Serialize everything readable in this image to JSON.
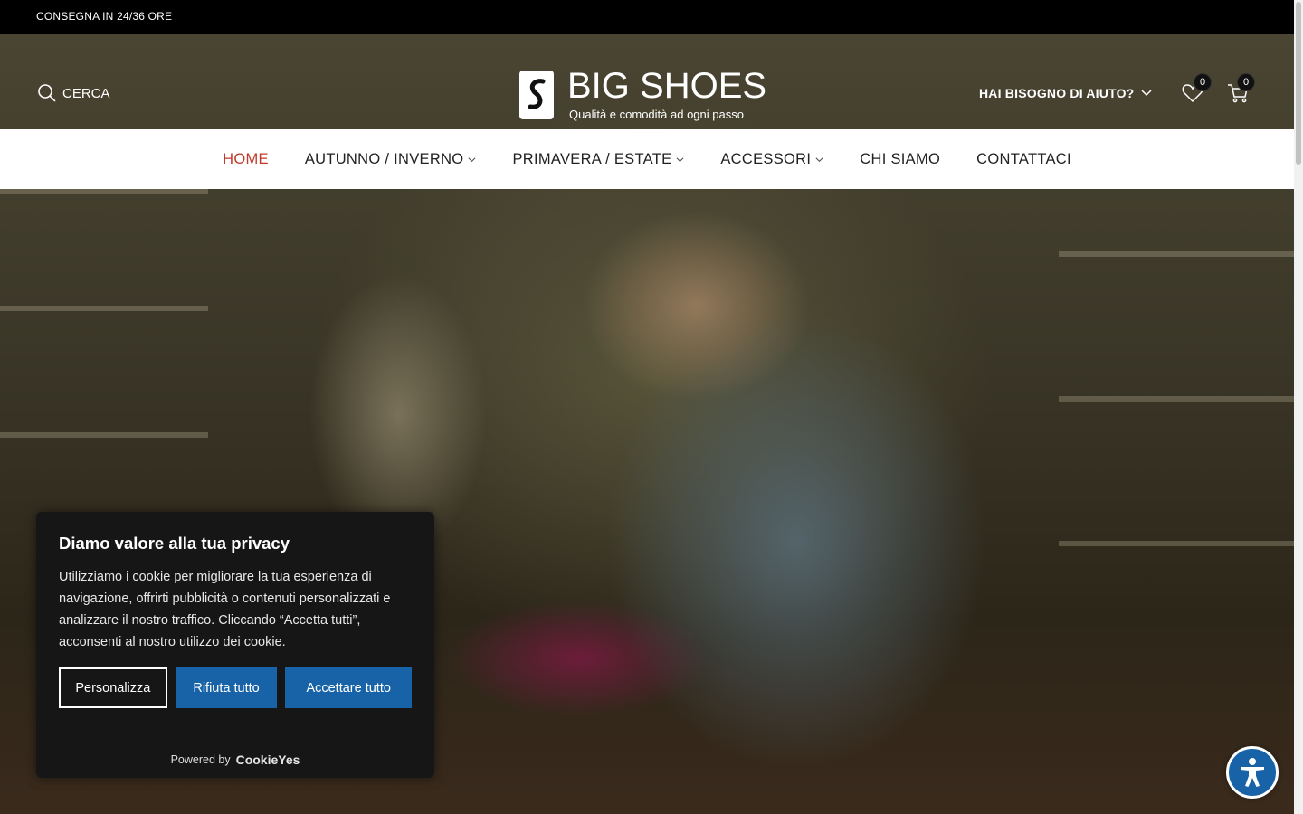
{
  "topbar": {
    "shipping": "CONSEGNA IN 24/36 ORE"
  },
  "header": {
    "search_label": "CERCA",
    "logo_title": "BIG SHOES",
    "logo_tagline": "Qualità e comodità ad ogni passo",
    "help_label": "HAI BISOGNO DI AIUTO?",
    "wishlist_count": "0",
    "cart_count": "0"
  },
  "nav": {
    "items": [
      {
        "label": "HOME",
        "active": true
      },
      {
        "label": "AUTUNNO / INVERNO",
        "dropdown": true
      },
      {
        "label": "PRIMAVERA / ESTATE",
        "dropdown": true
      },
      {
        "label": "ACCESSORI",
        "dropdown": true
      },
      {
        "label": "CHI SIAMO"
      },
      {
        "label": "CONTATTACI"
      }
    ]
  },
  "cookie": {
    "title": "Diamo valore alla tua privacy",
    "text": "Utilizziamo i cookie per migliorare la tua esperienza di navigazione, offrirti pubblicità o contenuti personalizzati e analizzare il nostro traffico. Cliccando “Accetta tutti”, acconsenti al nostro utilizzo dei cookie.",
    "customize_label": "Personalizza",
    "reject_label": "Rifiuta tutto",
    "accept_label": "Accettare tutto",
    "powered_by": "Powered by",
    "brand": "CookieYes"
  },
  "colors": {
    "accent": "#1863a8",
    "active_nav": "#c0392b",
    "topbar": "#000000"
  },
  "icons": {
    "search": "search-icon",
    "help_chevron": "chevron-down-icon",
    "wishlist": "heart-icon",
    "cart": "cart-icon",
    "accessibility": "accessibility-icon"
  }
}
